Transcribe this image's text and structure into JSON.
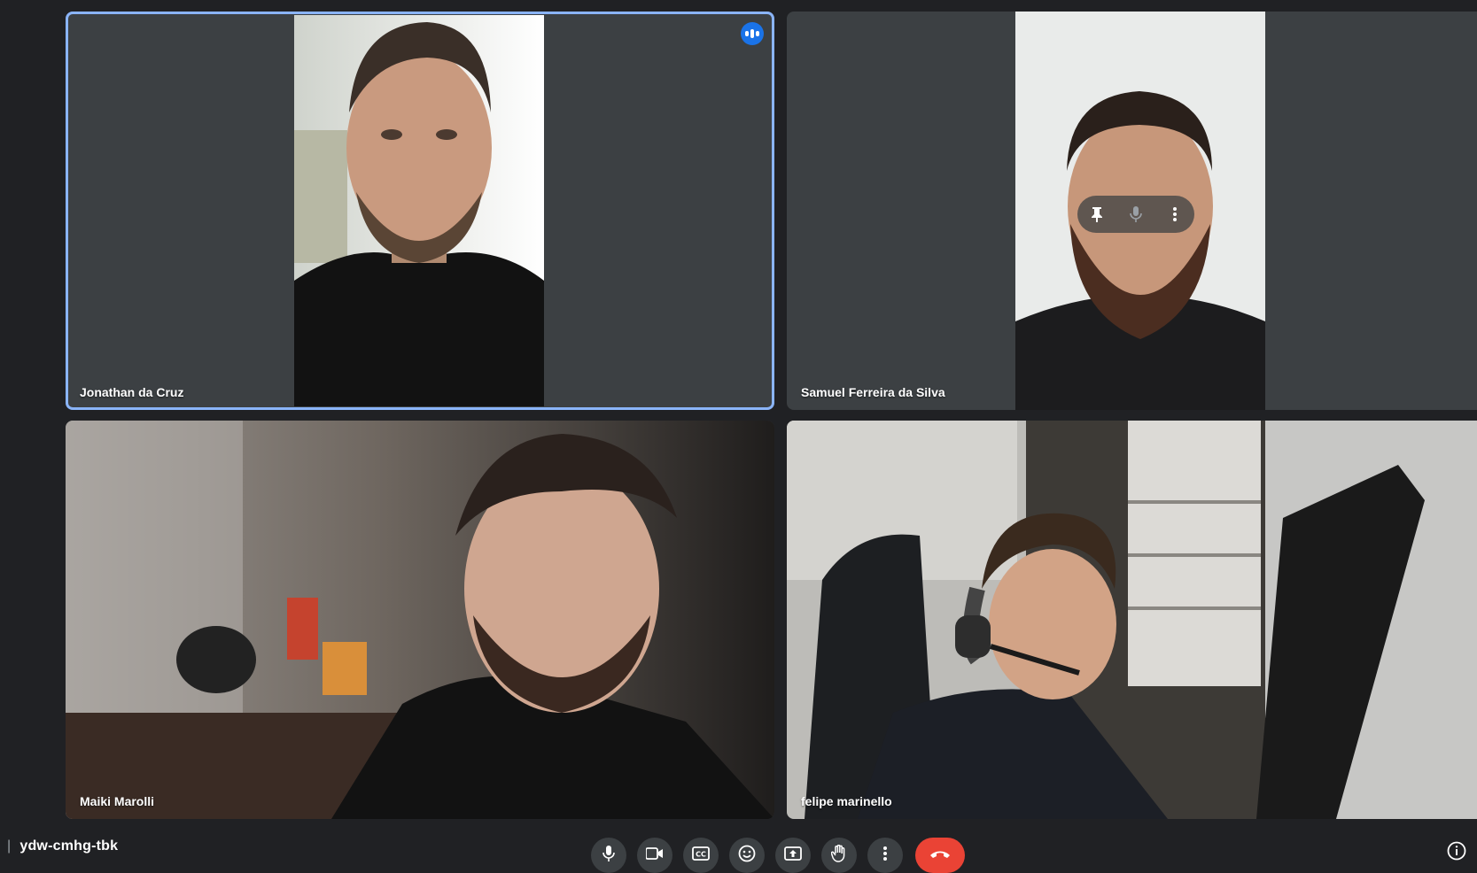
{
  "participants": [
    {
      "name": "Jonathan da Cruz",
      "speaking": true
    },
    {
      "name": "Samuel Ferreira da Silva",
      "speaking": false
    },
    {
      "name": "Maiki Marolli",
      "speaking": false
    },
    {
      "name": "felipe marinello",
      "speaking": false
    }
  ],
  "meeting": {
    "code": "ydw-cmhg-tbk"
  },
  "colors": {
    "background": "#202124",
    "tile": "#3c4043",
    "speaking_border": "#8ab4f8",
    "speaking_indicator": "#1a73e8",
    "end_call": "#ea4335"
  },
  "controls": [
    {
      "icon": "microphone-icon"
    },
    {
      "icon": "camera-icon"
    },
    {
      "icon": "closed-captions-icon"
    },
    {
      "icon": "emoji-icon"
    },
    {
      "icon": "present-screen-icon"
    },
    {
      "icon": "raise-hand-icon"
    },
    {
      "icon": "more-options-icon"
    },
    {
      "icon": "end-call-icon"
    }
  ],
  "tile_toolbar": [
    {
      "icon": "pin-icon"
    },
    {
      "icon": "mute-icon"
    },
    {
      "icon": "more-options-icon"
    }
  ]
}
